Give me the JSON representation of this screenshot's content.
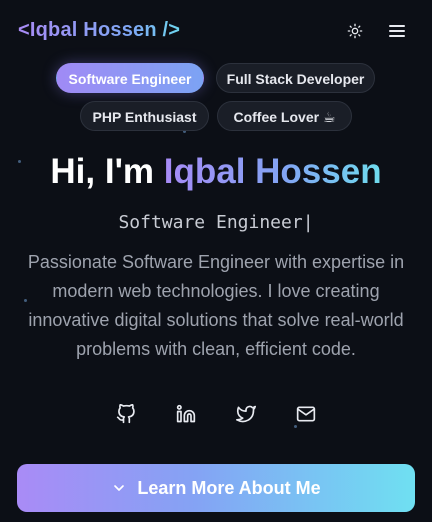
{
  "header": {
    "logo": "<Iqbal Hossen />",
    "theme_icon": "sun-icon",
    "menu_icon": "menu-icon"
  },
  "tags": [
    {
      "label": "Software Engineer",
      "active": true
    },
    {
      "label": "Full Stack Developer",
      "active": false
    },
    {
      "label": "PHP Enthusiast",
      "active": false
    },
    {
      "label": "Coffee Lover ☕",
      "active": false
    }
  ],
  "hero": {
    "greeting_prefix": "Hi, I'm ",
    "name": "Iqbal Hossen",
    "role": "Software Engineer",
    "caret": "|",
    "bio": "Passionate Software Engineer with expertise in modern web technologies. I love creating innovative digital solutions that solve real-world problems with clean, efficient code."
  },
  "socials": [
    {
      "icon": "github-icon"
    },
    {
      "icon": "linkedin-icon"
    },
    {
      "icon": "twitter-icon"
    },
    {
      "icon": "mail-icon"
    }
  ],
  "cta": {
    "label": "Learn More About Me",
    "icon": "chevron-down-icon"
  },
  "colors": {
    "background": "#0c0f16",
    "accent_start": "#a98bf6",
    "accent_mid": "#84a3f4",
    "accent_end": "#6fe0f2",
    "text_muted": "#9ea3ae"
  }
}
